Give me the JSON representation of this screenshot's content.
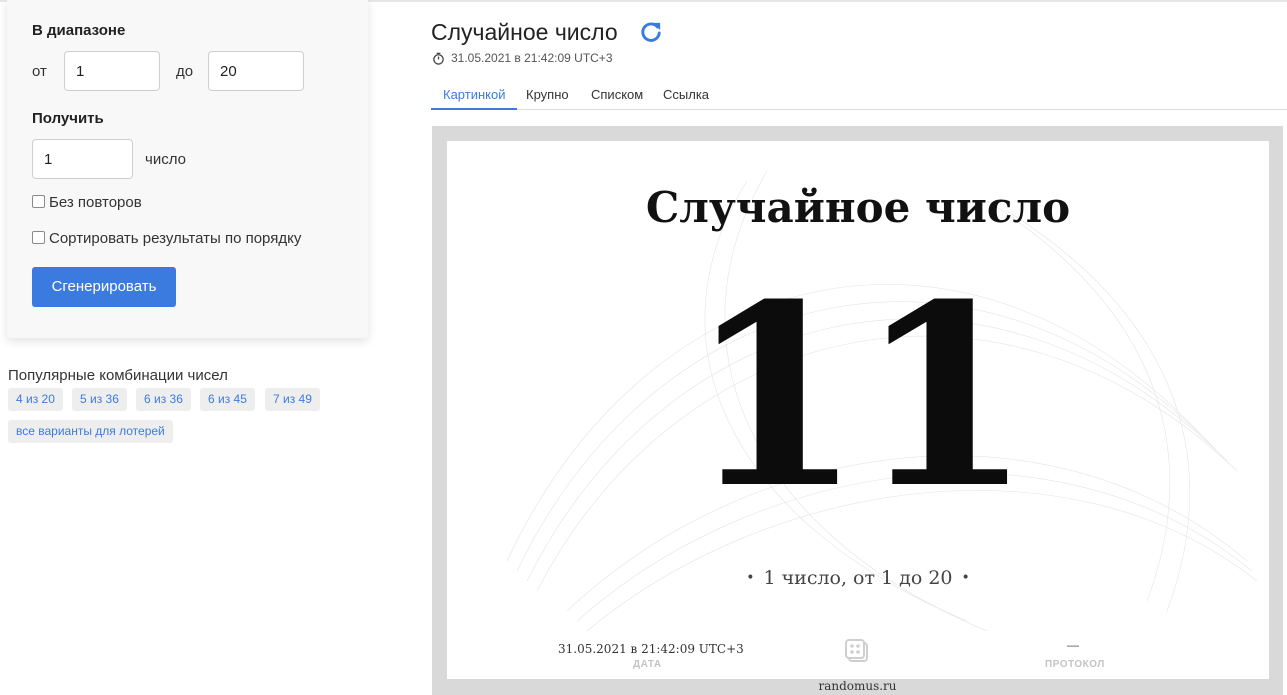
{
  "settings": {
    "range_title": "В диапазоне",
    "from_label": "от",
    "from_value": "1",
    "to_label": "до",
    "to_value": "20",
    "get_title": "Получить",
    "count_value": "1",
    "count_label": "число",
    "no_repeats_label": "Без повторов",
    "sort_label": "Сортировать результаты по порядку",
    "generate_label": "Сгенерировать"
  },
  "combos": {
    "title": "Популярные комбинации чисел",
    "items": [
      "4 из 20",
      "5 из 36",
      "6 из 36",
      "6 из 45",
      "7 из 49"
    ],
    "all_variants": "все варианты для лотерей"
  },
  "result": {
    "title": "Случайное число",
    "timestamp": "31.05.2021 в 21:42:09 UTC+3",
    "tabs": [
      "Картинкой",
      "Крупно",
      "Списком",
      "Ссылка"
    ],
    "active_tab": "Картинкой"
  },
  "picture": {
    "heading": "Случайное число",
    "number": "11",
    "caption": "1 число, от 1 до 20",
    "footer_date": "31.05.2021 в 21:42:09 UTC+3",
    "date_label": "ДАТА",
    "protocol_value": "—",
    "protocol_label": "ПРОТОКОЛ",
    "site": "randomus.ru"
  },
  "colors": {
    "accent": "#3b7be0",
    "frame": "#d9d9d9",
    "card_bg": "#f8f8f8"
  },
  "icons": {
    "refresh": "refresh-icon",
    "timer": "timer-icon",
    "dice": "dice-icon"
  }
}
